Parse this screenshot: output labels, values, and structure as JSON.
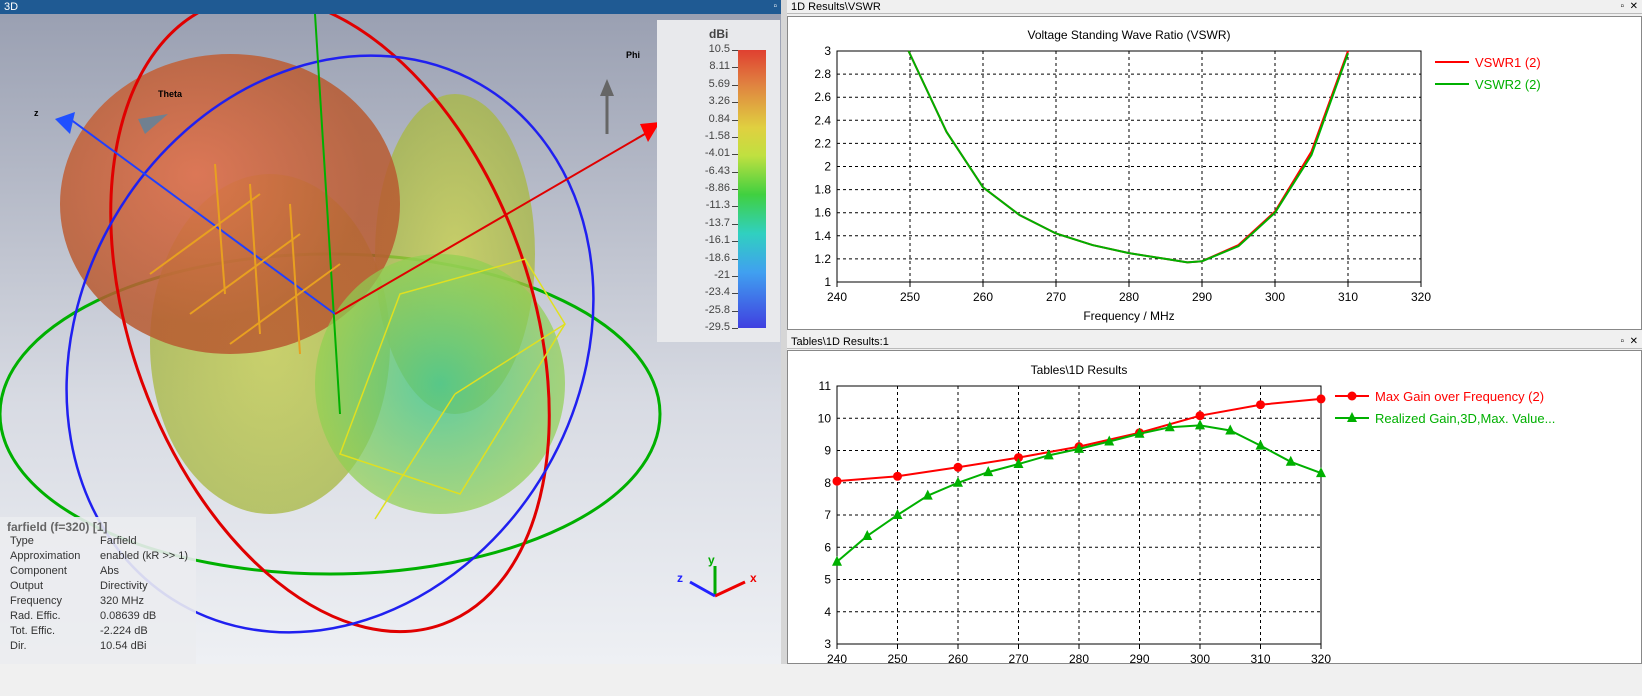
{
  "left_panel": {
    "title": "3D",
    "axis_labels": {
      "theta": "Theta",
      "phi": "Phi",
      "z": "z",
      "triad_x": "x",
      "triad_y": "y",
      "triad_z": "z"
    }
  },
  "colorbar": {
    "unit": "dBi",
    "ticks": [
      "10.5",
      "8.11",
      "5.69",
      "3.26",
      "0.84",
      "-1.58",
      "-4.01",
      "-6.43",
      "-8.86",
      "-11.3",
      "-13.7",
      "-16.1",
      "-18.6",
      "-21",
      "-23.4",
      "-25.8",
      "-29.5"
    ]
  },
  "info": {
    "header": "farfield (f=320) [1]",
    "rows": [
      {
        "k": "Type",
        "v": "Farfield"
      },
      {
        "k": "Approximation",
        "v": "enabled (kR >> 1)"
      },
      {
        "k": "Component",
        "v": "Abs"
      },
      {
        "k": "Output",
        "v": "Directivity"
      },
      {
        "k": "Frequency",
        "v": "320 MHz"
      },
      {
        "k": "Rad. Effic.",
        "v": "0.08639 dB"
      },
      {
        "k": "Tot. Effic.",
        "v": "-2.224 dB"
      },
      {
        "k": "Dir.",
        "v": "10.54 dBi"
      }
    ]
  },
  "top_panel": {
    "title": "1D Results\\VSWR"
  },
  "bottom_panel": {
    "title": "Tables\\1D Results:1"
  },
  "chart_data": [
    {
      "type": "line",
      "title": "Voltage Standing Wave Ratio (VSWR)",
      "xlabel": "Frequency / MHz",
      "ylabel": "",
      "xlim": [
        240,
        320
      ],
      "ylim": [
        1,
        3
      ],
      "xticks": [
        "240",
        "250",
        "260",
        "270",
        "280",
        "290",
        "300",
        "310",
        "320"
      ],
      "yticks": [
        "1",
        "1.2",
        "1.4",
        "1.6",
        "1.8",
        "2",
        "2.2",
        "2.4",
        "2.6",
        "2.8",
        "3"
      ],
      "legend": "right",
      "x": [
        249.8,
        255,
        260,
        265,
        270,
        275,
        280,
        285,
        288,
        290,
        295,
        300,
        305,
        310
      ],
      "series": [
        {
          "name": "VSWR1 (2)",
          "color": "#ff0000",
          "values": [
            3,
            2.3,
            1.82,
            1.58,
            1.42,
            1.32,
            1.25,
            1.2,
            1.17,
            1.18,
            1.32,
            1.61,
            2.13,
            3
          ]
        },
        {
          "name": "VSWR2 (2)",
          "color": "#00b000",
          "values": [
            3,
            2.3,
            1.82,
            1.58,
            1.42,
            1.32,
            1.25,
            1.2,
            1.17,
            1.18,
            1.31,
            1.6,
            2.1,
            2.98
          ]
        }
      ]
    },
    {
      "type": "line",
      "title": "Tables\\1D Results",
      "xlabel": "Frequency / MHz",
      "ylabel": "",
      "xlim": [
        240,
        320
      ],
      "ylim": [
        3,
        11
      ],
      "xticks": [
        "240",
        "250",
        "260",
        "270",
        "280",
        "290",
        "300",
        "310",
        "320"
      ],
      "yticks": [
        "3",
        "4",
        "5",
        "6",
        "7",
        "8",
        "9",
        "10",
        "11"
      ],
      "legend": "right",
      "series": [
        {
          "name": "Max Gain over Frequency (2)",
          "color": "#ff0000",
          "marker": "circle",
          "x": [
            240,
            250,
            260,
            270,
            280,
            290,
            300,
            310,
            320
          ],
          "values": [
            8.05,
            8.2,
            8.48,
            8.78,
            9.12,
            9.55,
            10.08,
            10.42,
            10.6
          ]
        },
        {
          "name": "Realized Gain,3D,Max. Value...",
          "color": "#00b000",
          "marker": "triangle",
          "x": [
            240,
            245,
            250,
            255,
            260,
            265,
            270,
            275,
            280,
            285,
            290,
            295,
            300,
            305,
            310,
            315,
            320
          ],
          "values": [
            5.55,
            6.35,
            7.0,
            7.6,
            8.0,
            8.33,
            8.58,
            8.85,
            9.05,
            9.28,
            9.52,
            9.72,
            9.78,
            9.62,
            9.15,
            8.65,
            8.3
          ]
        }
      ]
    }
  ]
}
